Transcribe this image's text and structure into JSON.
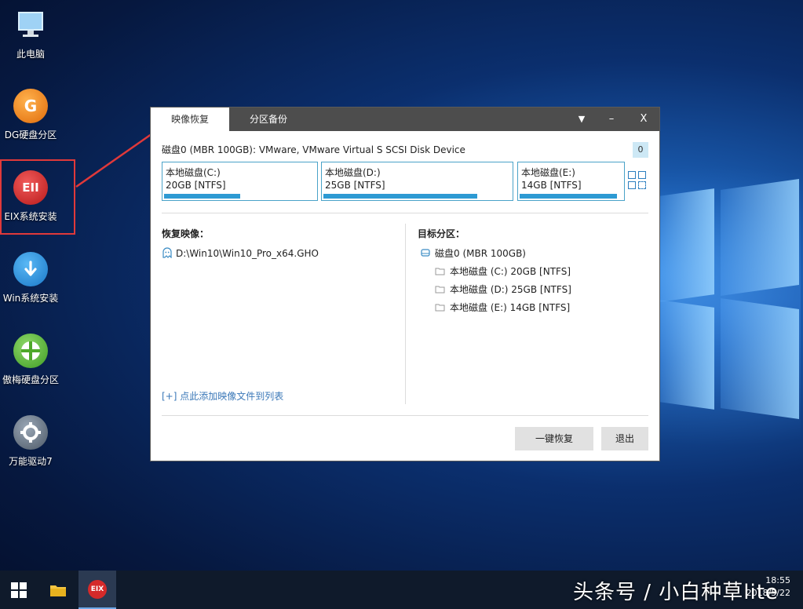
{
  "desktop": {
    "icons": [
      {
        "label": "此电脑",
        "icon": "computer-icon"
      },
      {
        "label": "DG硬盘分区",
        "icon": "dg-partition-icon"
      },
      {
        "label": "EIX系统安装",
        "icon": "eix-install-icon",
        "glyph": "EII"
      },
      {
        "label": "Win系统安装",
        "icon": "win-install-icon"
      },
      {
        "label": "傲梅硬盘分区",
        "icon": "aomei-partition-icon"
      },
      {
        "label": "万能驱动7",
        "icon": "driver-gear-icon"
      }
    ]
  },
  "dialog": {
    "tabs": [
      "映像恢复",
      "分区备份"
    ],
    "controls": {
      "menu": "▼",
      "minimize": "–",
      "close": "X"
    },
    "disk_title": "磁盘0 (MBR 100GB): VMware, VMware Virtual S SCSI Disk Device",
    "disk_badge": "0",
    "partitions": [
      {
        "name": "本地磁盘(C:)",
        "size": "20GB [NTFS]",
        "used_fraction": 0.5
      },
      {
        "name": "本地磁盘(D:)",
        "size": "25GB [NTFS]",
        "used_fraction": 0.82
      },
      {
        "name": "本地磁盘(E:)",
        "size": "14GB [NTFS]",
        "used_fraction": 0.95
      }
    ],
    "restore_label": "恢复映像：",
    "image_path": "D:\\Win10\\Win10_Pro_x64.GHO",
    "add_link": "[+] 点此添加映像文件到列表",
    "target_label": "目标分区：",
    "target_disk": "磁盘0 (MBR 100GB)",
    "target_partitions": [
      "本地磁盘 (C:) 20GB [NTFS]",
      "本地磁盘 (D:) 25GB [NTFS]",
      "本地磁盘 (E:) 14GB [NTFS]"
    ],
    "buttons": {
      "restore": "一键恢复",
      "exit": "退出"
    }
  },
  "taskbar": {
    "eix_label": "EIX",
    "watermark": "头条号 / 小白种草lite",
    "clock_time": "18:55",
    "clock_date": "2018/5/22"
  },
  "colors": {
    "accent": "#2d9ad3",
    "highlight": "#e0393a",
    "titlebar": "#4d4d4d"
  }
}
